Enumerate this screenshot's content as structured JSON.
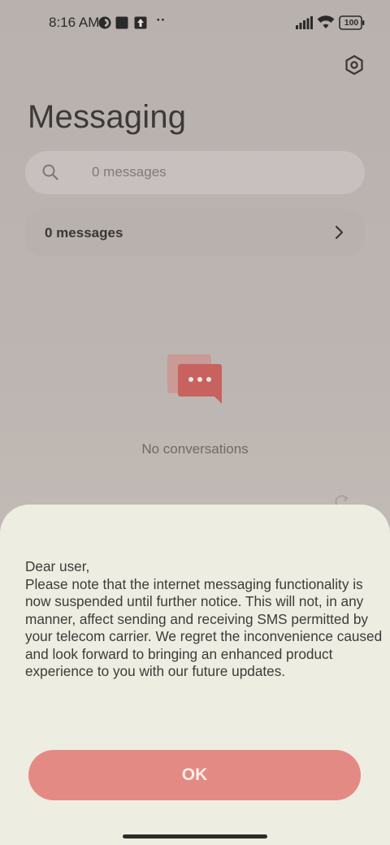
{
  "status_bar": {
    "time": "8:16 AM",
    "battery": "100",
    "icons": [
      "app-notification-icon",
      "square-notification-icon",
      "upload-notification-icon",
      "more-notifications-icon",
      "signal-icon",
      "wifi-icon",
      "battery-icon"
    ],
    "more_label": "··"
  },
  "header": {
    "title": "Messaging",
    "settings_icon": "settings-hexagon-icon"
  },
  "search": {
    "placeholder": "0 messages",
    "icon": "search-icon"
  },
  "folder": {
    "label": "0 messages",
    "icon": "chevron-right-icon"
  },
  "empty_state": {
    "icon": "chat-bubbles-icon",
    "label": "No conversations",
    "accent": "#c8625f"
  },
  "dialog": {
    "message": "Dear user,\nPlease note that the internet messaging functionality is now suspended until further notice. This will not, in any manner, affect sending and receiving SMS permitted by your telecom carrier. We regret the inconvenience caused and look forward to bringing an enhanced product experience to you with our future updates.",
    "ok_label": "OK",
    "ok_color": "#e48a84",
    "background": "#edede2"
  }
}
